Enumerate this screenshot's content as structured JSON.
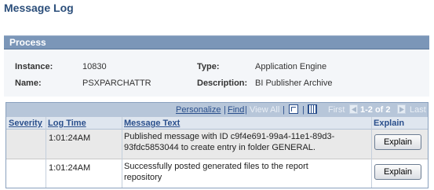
{
  "page": {
    "title": "Message Log"
  },
  "process": {
    "header": "Process",
    "instance_label": "Instance:",
    "instance_value": "10830",
    "type_label": "Type:",
    "type_value": "Application Engine",
    "name_label": "Name:",
    "name_value": "PSXPARCHATTR",
    "description_label": "Description:",
    "description_value": "BI Publisher Archive"
  },
  "grid": {
    "toolbar": {
      "personalize": "Personalize",
      "sep1": "|",
      "find": "Find",
      "sep2": "|",
      "view_all": "View All",
      "sep3": "|",
      "first": "First",
      "range": "1-2 of 2",
      "last": "Last",
      "zoom_icon": "zoom-icon",
      "download_icon": "download-grid-icon"
    },
    "columns": {
      "severity": "Severity",
      "log_time": "Log Time",
      "message_text": "Message Text",
      "explain": "Explain"
    },
    "rows": [
      {
        "severity": "",
        "log_time": "1:01:24AM",
        "message_line1": "Published message with ID c9f4e691-99a4-11e1-89d3-",
        "message_line2": "93fdc5853044 to create entry in folder GENERAL.",
        "button": "Explain"
      },
      {
        "severity": "",
        "log_time": "1:01:24AM",
        "message_line1": "Successfully posted generated files to the report",
        "message_line2": "repository",
        "button": "Explain"
      }
    ]
  },
  "colors": {
    "title": "#2b4e7a",
    "section_header": "#7b96b8",
    "grid_toolbar": "#b7c6d9",
    "link": "#2a4f8c",
    "row_shaded": "#e9e9e9"
  }
}
